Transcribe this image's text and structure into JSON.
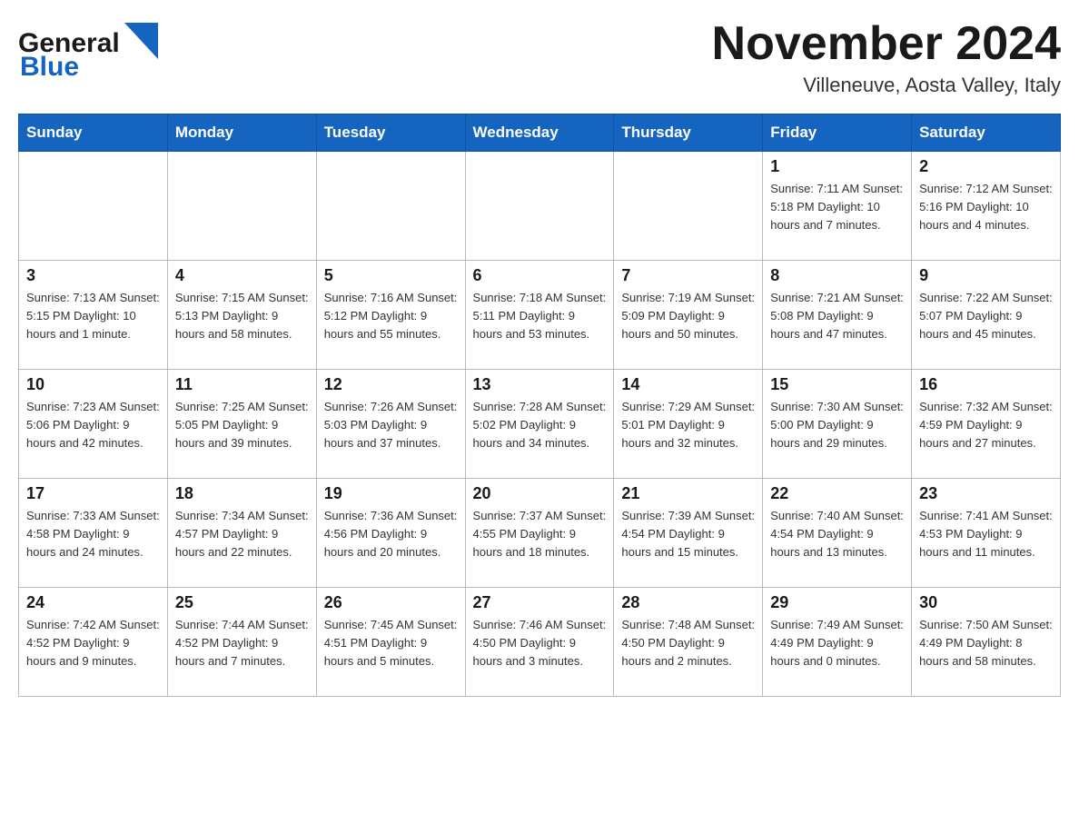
{
  "header": {
    "logo_general": "General",
    "logo_blue": "Blue",
    "month_title": "November 2024",
    "location": "Villeneuve, Aosta Valley, Italy"
  },
  "weekdays": [
    "Sunday",
    "Monday",
    "Tuesday",
    "Wednesday",
    "Thursday",
    "Friday",
    "Saturday"
  ],
  "weeks": [
    {
      "days": [
        {
          "num": "",
          "info": ""
        },
        {
          "num": "",
          "info": ""
        },
        {
          "num": "",
          "info": ""
        },
        {
          "num": "",
          "info": ""
        },
        {
          "num": "",
          "info": ""
        },
        {
          "num": "1",
          "info": "Sunrise: 7:11 AM\nSunset: 5:18 PM\nDaylight: 10 hours\nand 7 minutes."
        },
        {
          "num": "2",
          "info": "Sunrise: 7:12 AM\nSunset: 5:16 PM\nDaylight: 10 hours\nand 4 minutes."
        }
      ]
    },
    {
      "days": [
        {
          "num": "3",
          "info": "Sunrise: 7:13 AM\nSunset: 5:15 PM\nDaylight: 10 hours\nand 1 minute."
        },
        {
          "num": "4",
          "info": "Sunrise: 7:15 AM\nSunset: 5:13 PM\nDaylight: 9 hours\nand 58 minutes."
        },
        {
          "num": "5",
          "info": "Sunrise: 7:16 AM\nSunset: 5:12 PM\nDaylight: 9 hours\nand 55 minutes."
        },
        {
          "num": "6",
          "info": "Sunrise: 7:18 AM\nSunset: 5:11 PM\nDaylight: 9 hours\nand 53 minutes."
        },
        {
          "num": "7",
          "info": "Sunrise: 7:19 AM\nSunset: 5:09 PM\nDaylight: 9 hours\nand 50 minutes."
        },
        {
          "num": "8",
          "info": "Sunrise: 7:21 AM\nSunset: 5:08 PM\nDaylight: 9 hours\nand 47 minutes."
        },
        {
          "num": "9",
          "info": "Sunrise: 7:22 AM\nSunset: 5:07 PM\nDaylight: 9 hours\nand 45 minutes."
        }
      ]
    },
    {
      "days": [
        {
          "num": "10",
          "info": "Sunrise: 7:23 AM\nSunset: 5:06 PM\nDaylight: 9 hours\nand 42 minutes."
        },
        {
          "num": "11",
          "info": "Sunrise: 7:25 AM\nSunset: 5:05 PM\nDaylight: 9 hours\nand 39 minutes."
        },
        {
          "num": "12",
          "info": "Sunrise: 7:26 AM\nSunset: 5:03 PM\nDaylight: 9 hours\nand 37 minutes."
        },
        {
          "num": "13",
          "info": "Sunrise: 7:28 AM\nSunset: 5:02 PM\nDaylight: 9 hours\nand 34 minutes."
        },
        {
          "num": "14",
          "info": "Sunrise: 7:29 AM\nSunset: 5:01 PM\nDaylight: 9 hours\nand 32 minutes."
        },
        {
          "num": "15",
          "info": "Sunrise: 7:30 AM\nSunset: 5:00 PM\nDaylight: 9 hours\nand 29 minutes."
        },
        {
          "num": "16",
          "info": "Sunrise: 7:32 AM\nSunset: 4:59 PM\nDaylight: 9 hours\nand 27 minutes."
        }
      ]
    },
    {
      "days": [
        {
          "num": "17",
          "info": "Sunrise: 7:33 AM\nSunset: 4:58 PM\nDaylight: 9 hours\nand 24 minutes."
        },
        {
          "num": "18",
          "info": "Sunrise: 7:34 AM\nSunset: 4:57 PM\nDaylight: 9 hours\nand 22 minutes."
        },
        {
          "num": "19",
          "info": "Sunrise: 7:36 AM\nSunset: 4:56 PM\nDaylight: 9 hours\nand 20 minutes."
        },
        {
          "num": "20",
          "info": "Sunrise: 7:37 AM\nSunset: 4:55 PM\nDaylight: 9 hours\nand 18 minutes."
        },
        {
          "num": "21",
          "info": "Sunrise: 7:39 AM\nSunset: 4:54 PM\nDaylight: 9 hours\nand 15 minutes."
        },
        {
          "num": "22",
          "info": "Sunrise: 7:40 AM\nSunset: 4:54 PM\nDaylight: 9 hours\nand 13 minutes."
        },
        {
          "num": "23",
          "info": "Sunrise: 7:41 AM\nSunset: 4:53 PM\nDaylight: 9 hours\nand 11 minutes."
        }
      ]
    },
    {
      "days": [
        {
          "num": "24",
          "info": "Sunrise: 7:42 AM\nSunset: 4:52 PM\nDaylight: 9 hours\nand 9 minutes."
        },
        {
          "num": "25",
          "info": "Sunrise: 7:44 AM\nSunset: 4:52 PM\nDaylight: 9 hours\nand 7 minutes."
        },
        {
          "num": "26",
          "info": "Sunrise: 7:45 AM\nSunset: 4:51 PM\nDaylight: 9 hours\nand 5 minutes."
        },
        {
          "num": "27",
          "info": "Sunrise: 7:46 AM\nSunset: 4:50 PM\nDaylight: 9 hours\nand 3 minutes."
        },
        {
          "num": "28",
          "info": "Sunrise: 7:48 AM\nSunset: 4:50 PM\nDaylight: 9 hours\nand 2 minutes."
        },
        {
          "num": "29",
          "info": "Sunrise: 7:49 AM\nSunset: 4:49 PM\nDaylight: 9 hours\nand 0 minutes."
        },
        {
          "num": "30",
          "info": "Sunrise: 7:50 AM\nSunset: 4:49 PM\nDaylight: 8 hours\nand 58 minutes."
        }
      ]
    }
  ]
}
